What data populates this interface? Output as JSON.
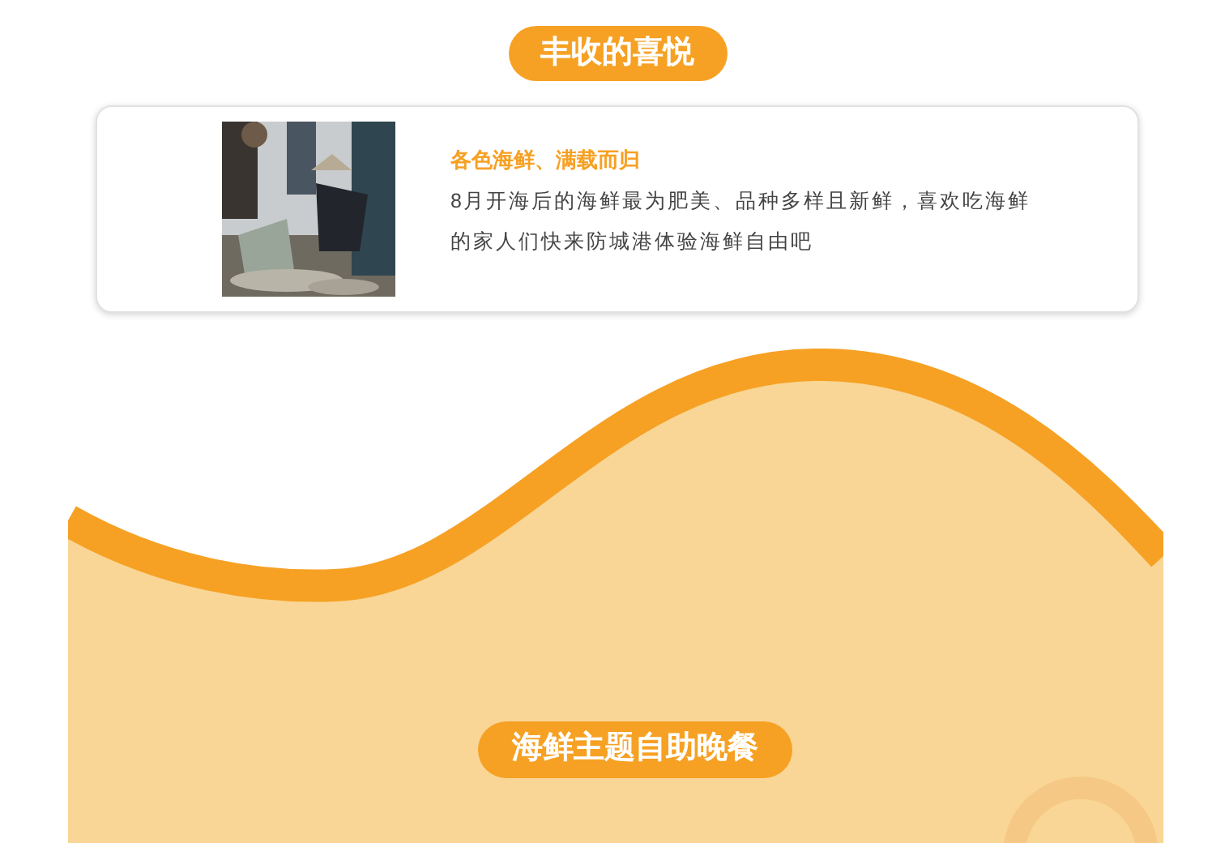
{
  "header_badge": "丰收的喜悦",
  "card": {
    "title": "各色海鲜、满载而归",
    "description": "8月开海后的海鲜最为肥美、品种多样且新鲜，喜欢吃海鲜的家人们快来防城港体验海鲜自由吧"
  },
  "section_badge": "海鲜主题自助晚餐"
}
